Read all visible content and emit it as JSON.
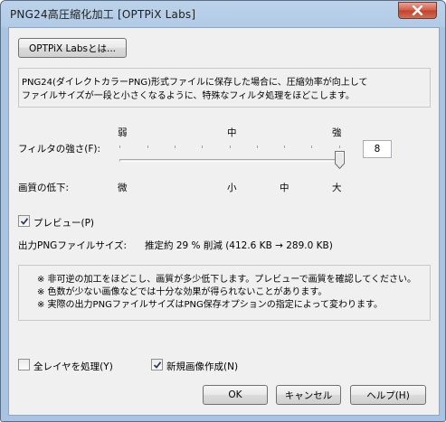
{
  "window": {
    "title": "PNG24高圧縮化加工 [OPTPiX Labs]"
  },
  "about_button": {
    "label": "OPTPiX Labsとは..."
  },
  "description": {
    "line1": "PNG24(ダイレクトカラーPNG)形式ファイルに保存した場合に、圧縮効率が向上して",
    "line2": "ファイルサイズが一段と小さくなるように、特殊なフィルタ処理をほどこします。"
  },
  "filter_strength": {
    "scale_labels": [
      "弱",
      "中",
      "強"
    ],
    "label": "フィルタの強さ(F):",
    "value": "8",
    "slider_fraction": 1.0
  },
  "quality_drop": {
    "label": "画質の低下:",
    "scale_labels": [
      "微",
      "小",
      "中",
      "大"
    ]
  },
  "preview": {
    "label": "プレビュー(P)",
    "checked": true
  },
  "output_size": {
    "label": "出力PNGファイルサイズ:",
    "value": "推定約 29 % 削減 (412.6 KB → 289.0 KB)"
  },
  "notes": {
    "line1": "※ 非可逆の加工をほどこし、画質が多少低下します。プレビューで画質を確認してください。",
    "line2": "※ 色数が少ない画像などでは十分な効果が得られないことがあります。",
    "line3": "※ 実際の出力PNGファイルサイズはPNG保存オプションの指定によって変わります。"
  },
  "all_layers": {
    "label": "全レイヤを処理(Y)",
    "checked": false
  },
  "new_image": {
    "label": "新規画像作成(N)",
    "checked": true
  },
  "buttons": {
    "ok": "OK",
    "cancel": "キャンセル",
    "help": "ヘルプ(H)"
  },
  "icons": {
    "close": "close-icon",
    "check": "checkmark-icon"
  },
  "colors": {
    "titlebar": "#b2cbe6",
    "close_button": "#c3412c",
    "client": "#f0f0f0"
  }
}
